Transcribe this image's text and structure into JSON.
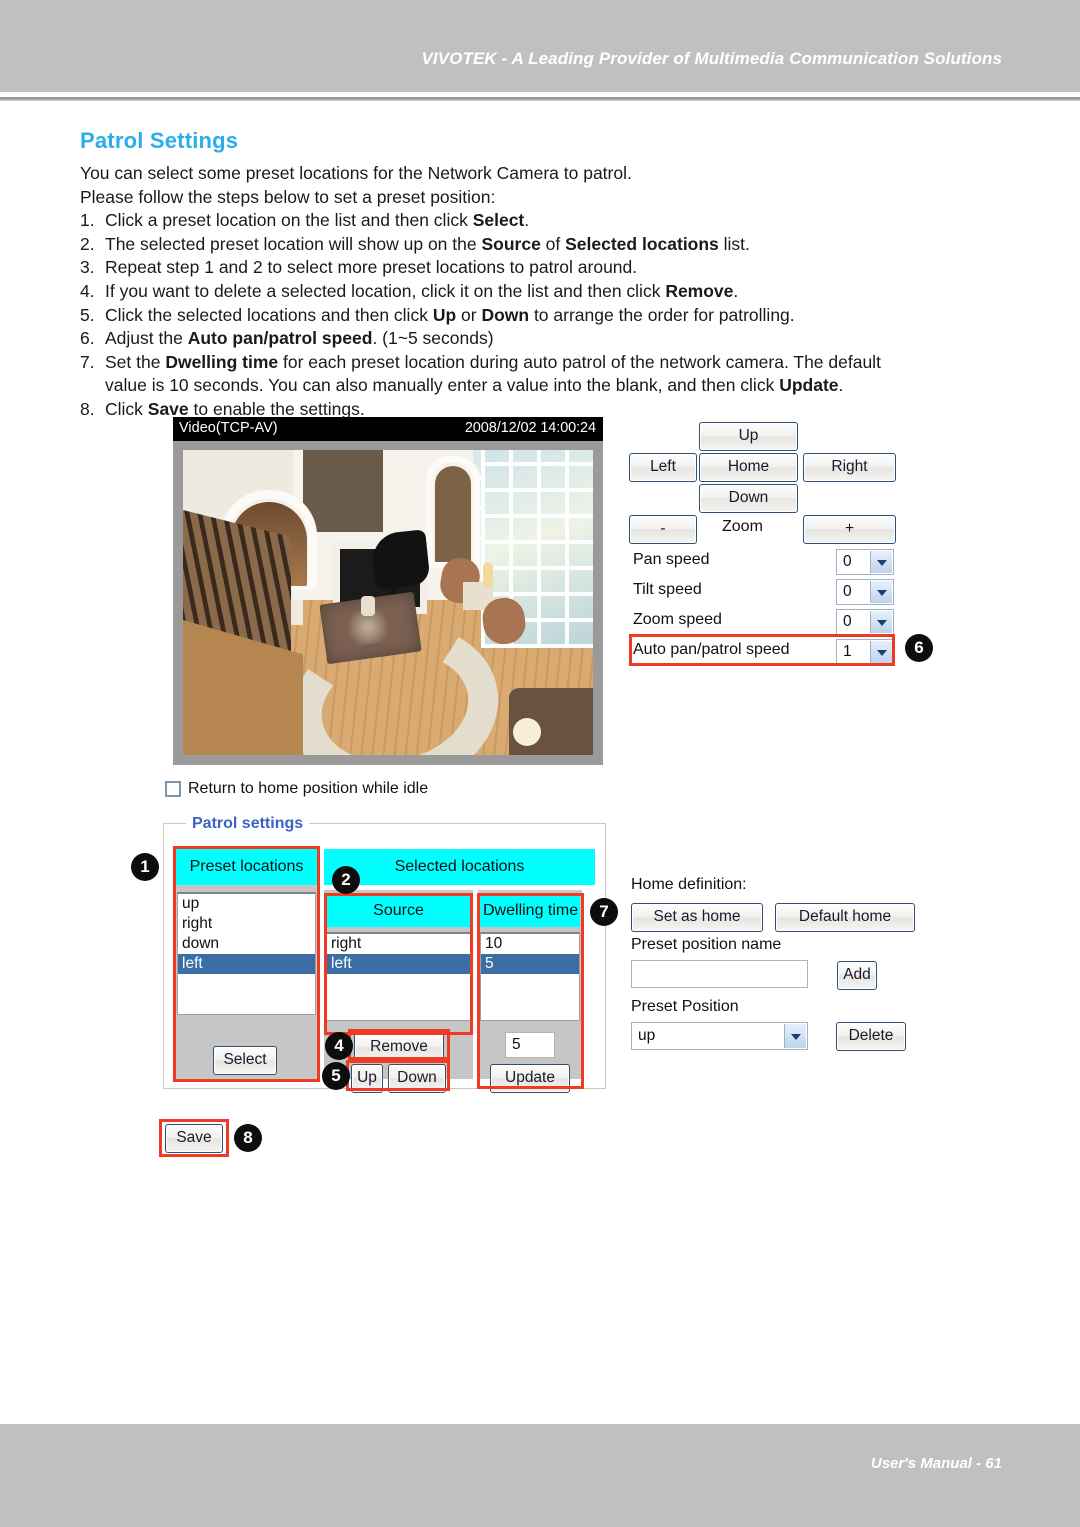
{
  "page": {
    "header_title": "VIVOTEK - A Leading Provider of Multimedia Communication Solutions",
    "footer_text": "User's Manual - 61"
  },
  "doc": {
    "title": "Patrol Settings",
    "intro_1": "You can select some preset locations for the Network Camera to patrol.",
    "intro_2": "Please follow the steps below to set a preset position:",
    "steps": [
      {
        "num": "1.",
        "pre": "Click a preset location on the list and then click ",
        "bold": "Select",
        "post": "."
      },
      {
        "num": "2.",
        "pre": "The selected preset location will show up on the ",
        "bold": "Source",
        "mid": " of ",
        "bold2": "Selected locations",
        "post": " list."
      },
      {
        "num": "3.",
        "pre": "Repeat step 1 and 2 to select more preset locations to patrol around.",
        "bold": "",
        "post": ""
      },
      {
        "num": "4.",
        "pre": "If you want to delete a selected location, click it on the list and then click ",
        "bold": "Remove",
        "post": "."
      },
      {
        "num": "5.",
        "pre": "Click the selected locations and then click ",
        "bold": "Up",
        "mid": " or ",
        "bold2": "Down",
        "post": " to arrange the order for patrolling."
      },
      {
        "num": "6.",
        "pre": "Adjust the ",
        "bold": "Auto pan/patrol speed",
        "post": ". (1~5 seconds)"
      },
      {
        "num": "7.",
        "pre": "Set the ",
        "bold": "Dwelling time",
        "post": " for each preset location during auto patrol of the network camera. The default"
      },
      {
        "num": "",
        "pre": "value is 10 seconds. You can also manually enter a value into the blank, and then click ",
        "bold": "Update",
        "post": "."
      },
      {
        "num": "8.",
        "pre": "Click ",
        "bold": "Save",
        "post": " to enable the settings."
      }
    ]
  },
  "camera_ui": {
    "video": {
      "stream_label": "Video(TCP-AV)",
      "timestamp": "2008/12/02 14:00:24"
    },
    "ptz": {
      "up": "Up",
      "left": "Left",
      "home": "Home",
      "right": "Right",
      "down": "Down",
      "zoom_out": "-",
      "zoom_label": "Zoom",
      "zoom_in": "+"
    },
    "speeds": [
      {
        "label": "Pan speed",
        "value": "0"
      },
      {
        "label": "Tilt speed",
        "value": "0"
      },
      {
        "label": "Zoom speed",
        "value": "0"
      },
      {
        "label": "Auto pan/patrol speed",
        "value": "1"
      }
    ],
    "return_home_checkbox": {
      "label": "Return to home position while idle",
      "checked": false
    },
    "patrol": {
      "legend": "Patrol settings",
      "preset_locations_header": "Preset locations",
      "preset_locations": [
        {
          "name": "up",
          "selected": false
        },
        {
          "name": "right",
          "selected": false
        },
        {
          "name": "down",
          "selected": false
        },
        {
          "name": "left",
          "selected": true
        }
      ],
      "select_button": "Select",
      "selected_locations_header": "Selected locations",
      "source_header": "Source",
      "dwelling_header": "Dwelling time",
      "source_items": [
        {
          "name": "right",
          "selected": false
        },
        {
          "name": "left",
          "selected": true
        }
      ],
      "dwelling_items": [
        {
          "value": "10",
          "selected": false
        },
        {
          "value": "5",
          "selected": true
        }
      ],
      "remove_button": "Remove",
      "up_button": "Up",
      "down_button": "Down",
      "dwelling_input_value": "5",
      "update_button": "Update"
    },
    "save_button": "Save",
    "home_definition": {
      "label": "Home definition:",
      "set_as_home": "Set as home",
      "default_home": "Default home",
      "preset_position_name_label": "Preset position name",
      "preset_position_name_value": "",
      "add_button": "Add",
      "preset_position_label": "Preset Position",
      "preset_position_value": "up",
      "delete_button": "Delete"
    },
    "callouts": [
      {
        "id": "1",
        "text": "1"
      },
      {
        "id": "2",
        "text": "2"
      },
      {
        "id": "4",
        "text": "4"
      },
      {
        "id": "5",
        "text": "5"
      },
      {
        "id": "6",
        "text": "6"
      },
      {
        "id": "7",
        "text": "7"
      },
      {
        "id": "8",
        "text": "8"
      }
    ]
  },
  "colors": {
    "accent_blue": "#2badea",
    "band_gray": "#bfc1c1",
    "highlight_red": "#ef3b21",
    "cyan_header": "#00ffff",
    "list_selection": "#3a6ea5"
  }
}
